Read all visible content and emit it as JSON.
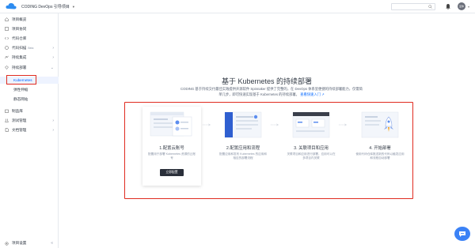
{
  "topbar": {
    "brand": "CODING DevOps 引导项目",
    "avatar_text": "爱你"
  },
  "sidebar": {
    "items": [
      {
        "label": "项目概览",
        "icon": "home-icon"
      },
      {
        "label": "项目协同",
        "icon": "task-icon"
      },
      {
        "label": "代码仓库",
        "icon": "code-icon"
      },
      {
        "label": "代码扫描",
        "badge": "Beta",
        "icon": "scan-icon",
        "expandable": true
      },
      {
        "label": "持续集成",
        "icon": "ci-icon",
        "expandable": true
      },
      {
        "label": "持续部署",
        "icon": "deploy-icon",
        "expanded": true
      }
    ],
    "sub_items": [
      {
        "label": "Kubernetes",
        "active": true
      },
      {
        "label": "弹性伸缩"
      },
      {
        "label": "静态网站"
      }
    ],
    "items_after": [
      {
        "label": "制品库",
        "icon": "package-icon"
      },
      {
        "label": "测试管理",
        "icon": "test-icon",
        "expandable": true
      },
      {
        "label": "文档管理",
        "icon": "doc-icon",
        "expandable": true
      }
    ],
    "bottom": {
      "label": "项目设置",
      "icon": "settings-icon",
      "collapse": "«"
    }
  },
  "main": {
    "title": "基于 Kubernetes 的持续部署",
    "desc": "CODING 基于持续交付最佳实践提供开源软件 Spinnaker 提供了完整的，在 DevOps 体系里便捷的持续部署能力，仅需简单几步，即可快速实现基于 Kubernetes 的持续部署。",
    "desc_link": "查看快速入门 ↗",
    "steps": [
      {
        "title": "1.配置云账号",
        "desc": "配置用于部署 Kubernetes 资源的云账号",
        "button": "立即配置"
      },
      {
        "title": "2.配置应用和流程",
        "desc": "配置应用和发布 Kubernetes 的应用和相应的部署流程"
      },
      {
        "title": "3. 关联项目和应用",
        "desc": "关联项目和应用进行部署，应用可以在多项目内关联"
      },
      {
        "title": "4. 开始部署",
        "desc": "使用代码仓库推送新的代码以触发应用和流程自动部署"
      }
    ]
  },
  "colors": {
    "accent": "#0066ff",
    "highlight": "#e02b20",
    "chat": "#3b82f6"
  }
}
